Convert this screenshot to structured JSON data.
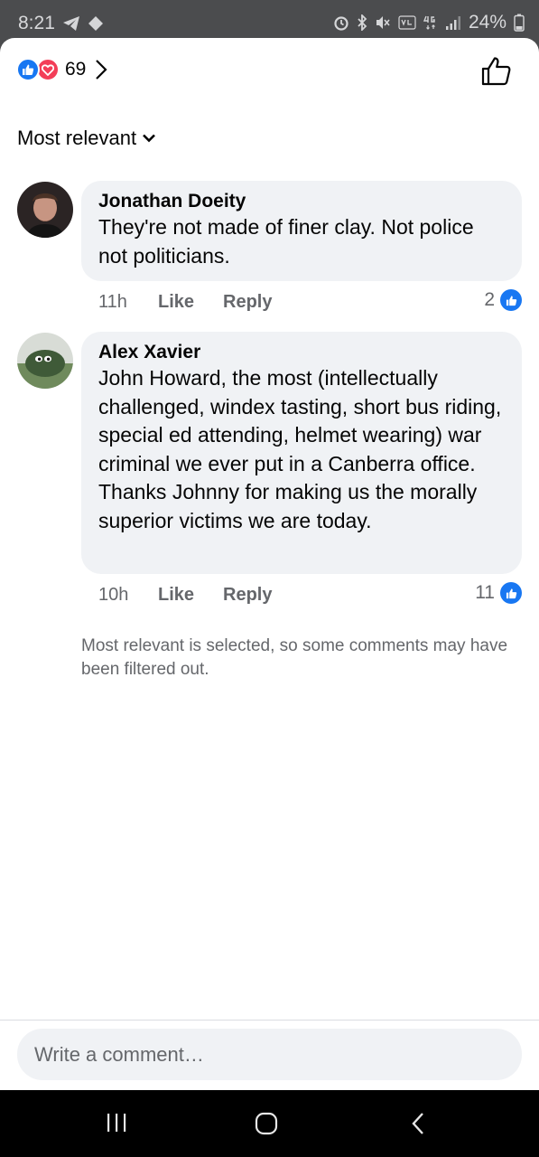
{
  "status_bar": {
    "time": "8:21",
    "battery_percent": "24%"
  },
  "header": {
    "reaction_count": "69",
    "reaction_types": [
      "like",
      "love"
    ]
  },
  "sort": {
    "label": "Most relevant"
  },
  "comments": [
    {
      "author": "Jonathan Doeity",
      "text": "They're not made of finer clay.  Not police not politicians.",
      "time": "11h",
      "like_label": "Like",
      "reply_label": "Reply",
      "like_count": "2"
    },
    {
      "author": "Alex Xavier",
      "text": "John Howard, the most (intellectually challenged, windex tasting, short bus riding, special ed attending, helmet wearing) war criminal we ever put in a Canberra office.\nThanks Johnny for making us the morally superior victims we are today.",
      "time": "10h",
      "like_label": "Like",
      "reply_label": "Reply",
      "like_count": "11"
    }
  ],
  "notice": "Most relevant is selected, so some comments may have been filtered out.",
  "composer": {
    "placeholder": "Write a comment…"
  },
  "colors": {
    "accent": "#1877f2",
    "love": "#f33e58",
    "bubble": "#f0f2f5",
    "secondary_text": "#65676b"
  }
}
